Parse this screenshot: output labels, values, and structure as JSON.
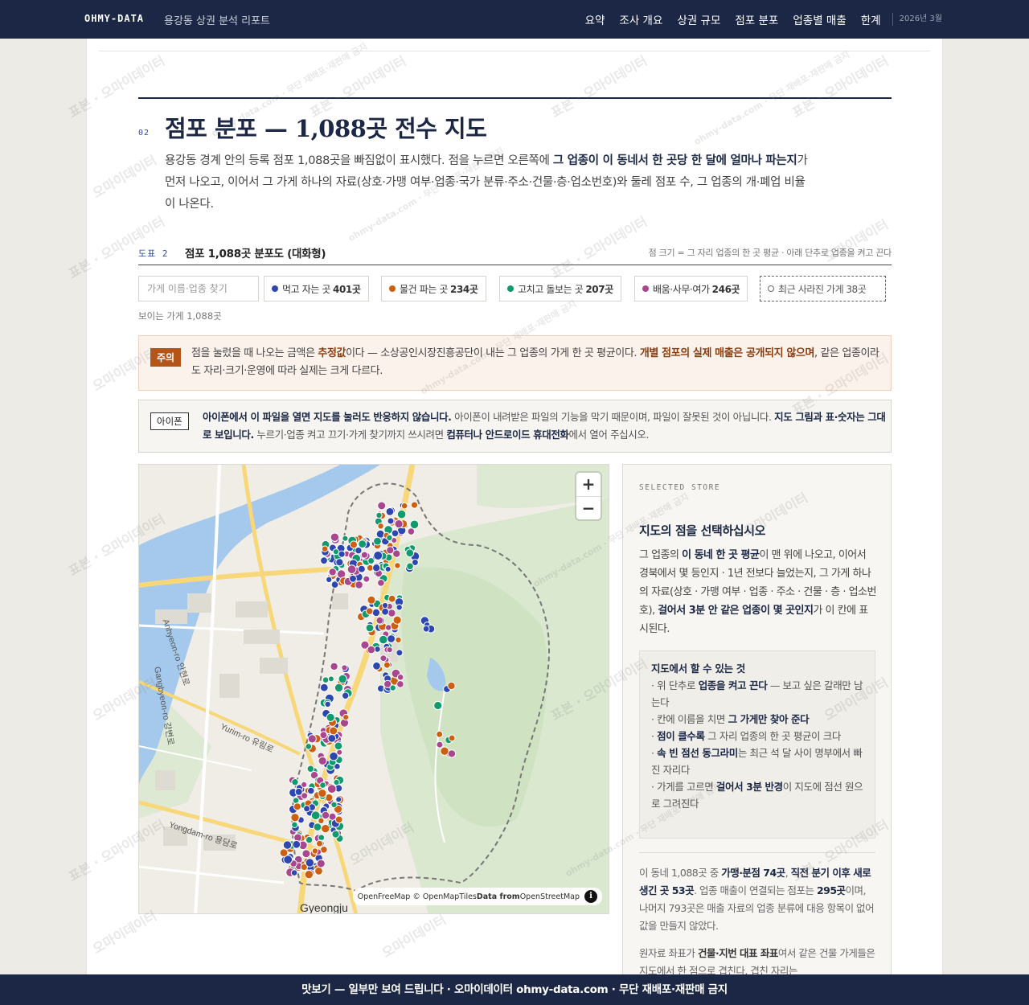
{
  "topbar": {
    "brand": "OHMY-DATA",
    "report_title": "용강동 상권 분석 리포트",
    "nav": [
      "요약",
      "조사 개요",
      "상권 규모",
      "점포 분포",
      "업종별 매출",
      "한계"
    ],
    "date": "2026년 3월"
  },
  "section": {
    "number": "02",
    "title": "점포 분포 — 1,088곳 전수 지도",
    "lead_1": "용강동 경계 안의 등록 점포 1,088곳을 빠짐없이 표시했다. 점을 누르면 오른쪽에 ",
    "lead_bold": "그 업종이 이 동네서 한 곳당 한 달에 얼마나 파는지",
    "lead_2": "가 먼저 나오고, 이어서 그 가게 하나의 자료(상호·가맹 여부·업종·국가 분류·주소·건물·층·업소번호)와 둘레 점포 수, 그 업종의 개·폐업 비율이 나온다."
  },
  "figure": {
    "number": "도표 2",
    "title": "점포 1,088곳 분포도 (대화형)",
    "note": "점 크기 = 그 자리 업종의 한 곳 평균 · 아래 단추로 업종을 켜고 끈다"
  },
  "filters": {
    "search_placeholder": "가게 이름·업종 찾기",
    "chips": [
      {
        "label": "먹고 자는 곳",
        "count": "401곳",
        "color": "#2d46b0"
      },
      {
        "label": "물건 파는 곳",
        "count": "234곳",
        "color": "#cc5f10"
      },
      {
        "label": "고치고 돌보는 곳",
        "count": "207곳",
        "color": "#119a6e"
      },
      {
        "label": "배움·사무·여가",
        "count": "246곳",
        "color": "#a8468e"
      },
      {
        "label": "최근 사라진 가게",
        "count": "38곳",
        "color": "#666666"
      }
    ],
    "visible_count": "보이는 가게 1,088곳"
  },
  "caution": {
    "tag": "주의",
    "text_1": "점을 눌렀을 때 나오는 금액은 ",
    "text_bold_1": "추정값",
    "text_2": "이다 — 소상공인시장진흥공단이 내는 그 업종의 가게 한 곳 평균이다. ",
    "text_bold_2": "개별 점포의 실제 매출은 공개되지 않으며",
    "text_3": ", 같은 업종이라도 자리·크기·운영에 따라 실제는 크게 다르다."
  },
  "iphone": {
    "tag": "아이폰",
    "bold_1": "아이폰에서 이 파일을 열면 지도를 눌러도 반응하지 않습니다.",
    "text_1": " 아이폰이 내려받은 파일의 기능을 막기 때문이며, 파일이 잘못된 것이 아닙니다. ",
    "bold_2": "지도 그림과 표·숫자는 그대로 보입니다.",
    "text_2": " 누르기·업종 켜고 끄기·가게 찾기까지 쓰시려면 ",
    "bold_3": "컴퓨터나 안드로이드 휴대전화",
    "text_3": "에서 열어 주십시오."
  },
  "map": {
    "zoom_in": "+",
    "zoom_out": "−",
    "attribution_1": "OpenFreeMap © OpenMapTiles ",
    "attribution_bold": "Data from",
    "attribution_2": " OpenStreetMap",
    "info": "i",
    "labels": {
      "anhyeon": "Anhyeon-ro 안현로",
      "gangbyeon": "Gangbyeon-ro 강변로",
      "yurim": "Yurim-ro 유림로",
      "yongdam": "Yongdam-ro 용담로",
      "gyeongju": "Gyeongju"
    }
  },
  "panel": {
    "kicker": "SELECTED STORE",
    "title": "지도의 점을 선택하십시오",
    "body_1": "그 업종의 ",
    "body_bold_1": "이 동네 한 곳 평균",
    "body_2": "이 맨 위에 나오고, 이어서 경북에서 몇 등인지 · 1년 전보다 늘었는지, 그 가게 하나의 자료(상호 · 가맹 여부 · 업종 · 주소 · 건물 · 층 · 업소번호), ",
    "body_bold_2": "걸어서 3분 안 같은 업종이 몇 곳인지",
    "body_3": "가 이 칸에 표시된다.",
    "howto_title": "지도에서 할 수 있는 것",
    "howto_1a": "· 위 단추로 ",
    "howto_1b": "업종을 켜고 끈다",
    "howto_1c": " — 보고 싶은 갈래만 남는다",
    "howto_2a": "· 칸에 이름을 치면 ",
    "howto_2b": "그 가게만 찾아 준다",
    "howto_3a": "· ",
    "howto_3b": "점이 클수록",
    "howto_3c": " 그 자리 업종의 한 곳 평균이 크다",
    "howto_4a": "· ",
    "howto_4b": "속 빈 점선 동그라미",
    "howto_4c": "는 최근 석 달 사이 명부에서 빠진 자리다",
    "howto_5a": "· 가게를 고르면 ",
    "howto_5b": "걸어서 3분 반경",
    "howto_5c": "이 지도에 점선 원으로 그려진다",
    "stats_1": "이 동네 1,088곳 중 ",
    "stats_bold_1": "가맹·분점 74곳",
    "stats_2": ", ",
    "stats_bold_2": "직전 분기 이후 새로 생긴 곳 53곳",
    "stats_3": ". 업종 매출이 연결되는 점포는 ",
    "stats_bold_3": "295곳",
    "stats_4": "이며, 나머지 793곳은 매출 자료의 업종 분류에 대응 항목이 없어 값을 만들지 않았다.",
    "src_1": "원자료 좌표가 ",
    "src_bold": "건물·지번 대표 좌표",
    "src_2": "여서 같은 건물 가게들은 지도에서 한 점으로 겹친다. 겹친 자리는"
  },
  "watermark": {
    "text": "표본 · 오마이데이터",
    "text_small": "ohmy-data.com · 무단 재배포·재판매 금지",
    "text_alt": "오마이데이터"
  },
  "banner": {
    "text": "맛보기 — 일부만 보여 드립니다 · 오마이데이터 ohmy-data.com · 무단 재배포·재판매 금지"
  },
  "colors": {
    "navy": "#1b2744",
    "food": "#2d46b0",
    "retail": "#cc5f10",
    "service": "#119a6e",
    "office": "#a8468e"
  }
}
